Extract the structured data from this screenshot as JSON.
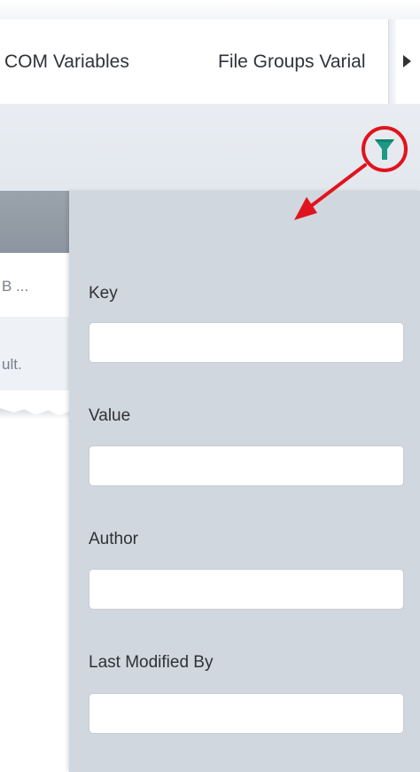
{
  "tabs": {
    "com_variables": "COM Variables",
    "file_groups": "File Groups Varial"
  },
  "left_table": {
    "row1_text": "B ...",
    "row2_text": "ult."
  },
  "filter": {
    "fields": [
      {
        "label": "Key",
        "value": ""
      },
      {
        "label": "Value",
        "value": ""
      },
      {
        "label": "Author",
        "value": ""
      },
      {
        "label": "Last Modified By",
        "value": ""
      }
    ]
  },
  "colors": {
    "filter_icon": "#1a9a82",
    "annotation": "#e0141e",
    "panel_bg": "#d1d7df"
  },
  "icons": {
    "filter": "funnel-icon",
    "scroll_right": "caret-right-icon"
  }
}
